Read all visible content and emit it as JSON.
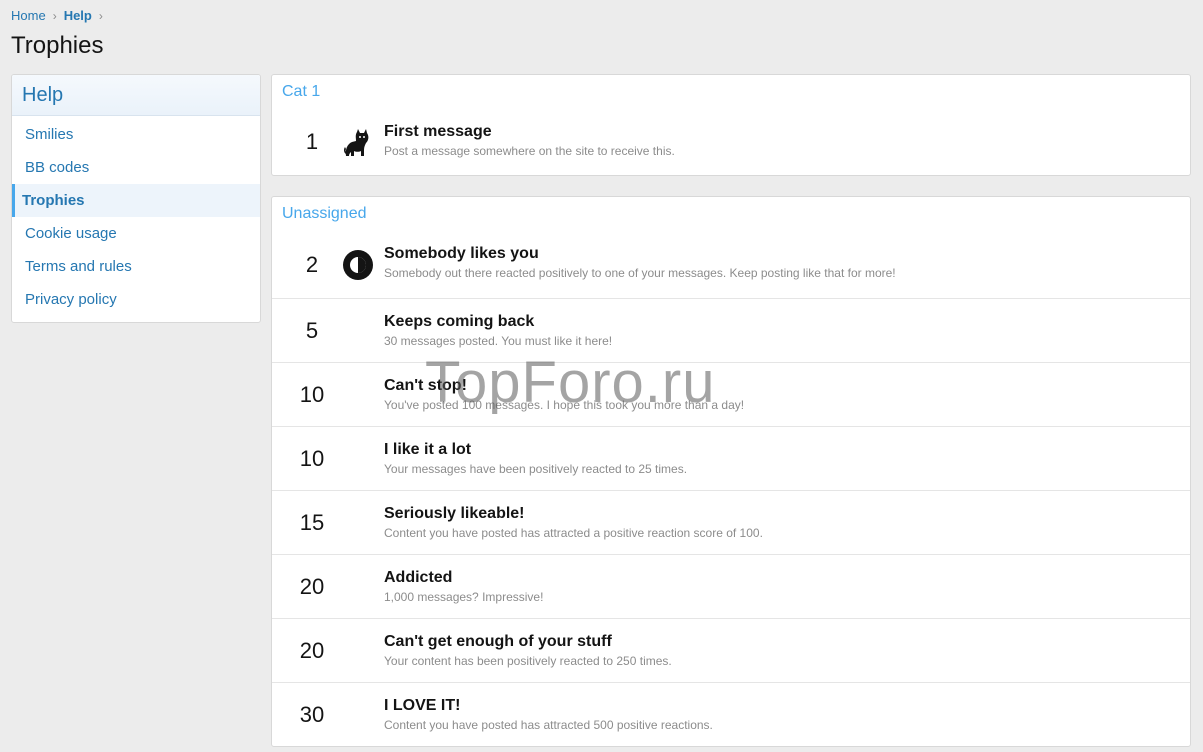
{
  "breadcrumb": {
    "home": "Home",
    "help": "Help",
    "separator": "›"
  },
  "page": {
    "title": "Trophies"
  },
  "sidebar": {
    "header": "Help",
    "items": [
      {
        "label": "Smilies"
      },
      {
        "label": "BB codes"
      },
      {
        "label": "Trophies",
        "active": true
      },
      {
        "label": "Cookie usage"
      },
      {
        "label": "Terms and rules"
      },
      {
        "label": "Privacy policy"
      }
    ]
  },
  "categories": [
    {
      "title": "Cat 1",
      "trophies": [
        {
          "points": "1",
          "title": "First message",
          "description": "Post a message somewhere on the site to receive this.",
          "icon": "cat-icon"
        }
      ]
    },
    {
      "title": "Unassigned",
      "trophies": [
        {
          "points": "2",
          "title": "Somebody likes you",
          "description": "Somebody out there reacted positively to one of your messages. Keep posting like that for more!",
          "icon": "contrast-circle-icon"
        },
        {
          "points": "5",
          "title": "Keeps coming back",
          "description": "30 messages posted. You must like it here!"
        },
        {
          "points": "10",
          "title": "Can't stop!",
          "description": "You've posted 100 messages. I hope this took you more than a day!"
        },
        {
          "points": "10",
          "title": "I like it a lot",
          "description": "Your messages have been positively reacted to 25 times."
        },
        {
          "points": "15",
          "title": "Seriously likeable!",
          "description": "Content you have posted has attracted a positive reaction score of 100."
        },
        {
          "points": "20",
          "title": "Addicted",
          "description": "1,000 messages? Impressive!"
        },
        {
          "points": "20",
          "title": "Can't get enough of your stuff",
          "description": "Your content has been positively reacted to 250 times."
        },
        {
          "points": "30",
          "title": "I LOVE IT!",
          "description": "Content you have posted has attracted 500 positive reactions."
        }
      ]
    }
  ],
  "watermark": "TopForo.ru",
  "colors": {
    "link": "#2577b1",
    "accent": "#47a7eb",
    "background": "#ececec"
  }
}
